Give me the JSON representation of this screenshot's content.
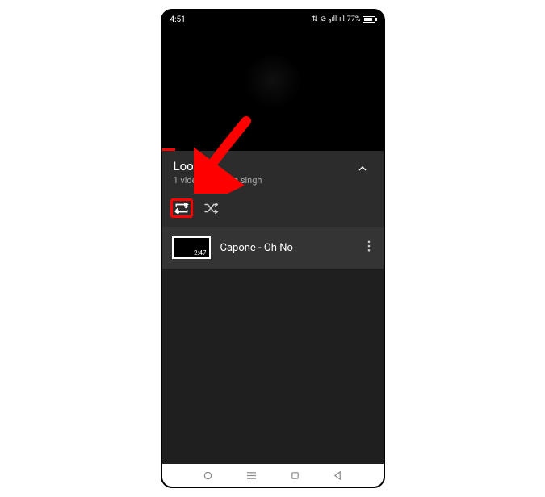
{
  "status": {
    "time": "4:51",
    "battery_pct": "77%",
    "battery_fill_pct": 77
  },
  "playlist": {
    "title": "Loop",
    "subtitle": "1 video • Bhavna singh"
  },
  "video_item": {
    "title": "Capone - Oh No",
    "duration": "2:47"
  }
}
